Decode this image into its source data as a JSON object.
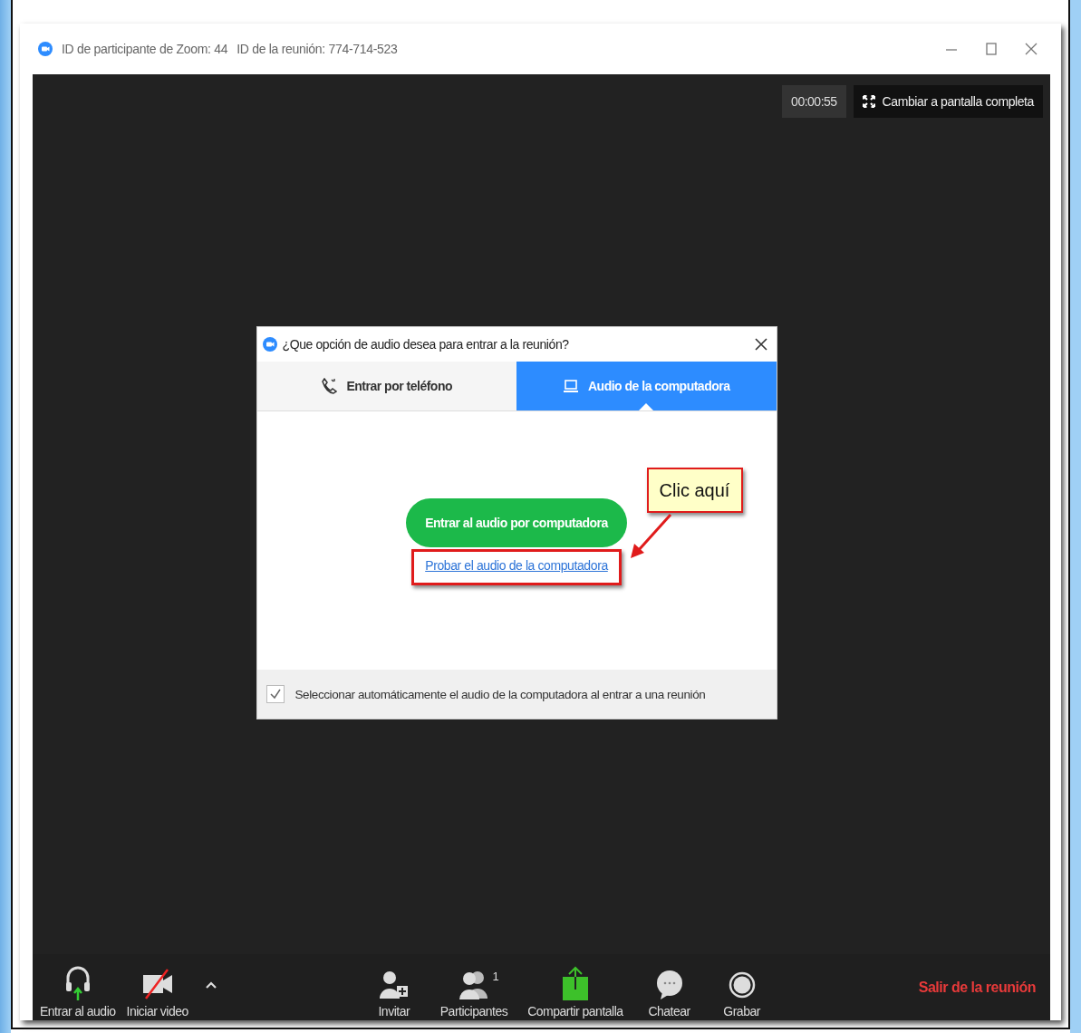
{
  "window": {
    "title_parts": [
      "ID de participante de Zoom: 44",
      "ID de la reunión: 774-714-523"
    ]
  },
  "timer": "00:00:55",
  "fullscreen_button": "Cambiar a pantalla completa",
  "dialog": {
    "title": "¿Que opción de audio desea para entrar a la reunión?",
    "tabs": [
      {
        "label": "Entrar por teléfono",
        "kind": "phone",
        "selected": false
      },
      {
        "label": "Audio de la computadora",
        "kind": "computer",
        "selected": true
      }
    ],
    "join_button": "Entrar al audio por computadora",
    "test_link": "Probar el audio de la computadora",
    "auto_select": {
      "label": "Seleccionar automáticamente el audio de la computadora al entrar a una reunión",
      "checked": true
    }
  },
  "annotation": {
    "text": "Clic aquí"
  },
  "toolbar": {
    "left": [
      {
        "label": "Entrar al audio",
        "kind": "audio"
      },
      {
        "label": "Iniciar video",
        "kind": "video"
      }
    ],
    "center": [
      {
        "label": "Invitar",
        "kind": "invite"
      },
      {
        "label": "Participantes",
        "kind": "participants",
        "badge": "1"
      },
      {
        "label": "Compartir pantalla",
        "kind": "share"
      },
      {
        "label": "Chatear",
        "kind": "chat"
      },
      {
        "label": "Grabar",
        "kind": "record"
      }
    ],
    "leave_button": "Salir de la reunión"
  }
}
